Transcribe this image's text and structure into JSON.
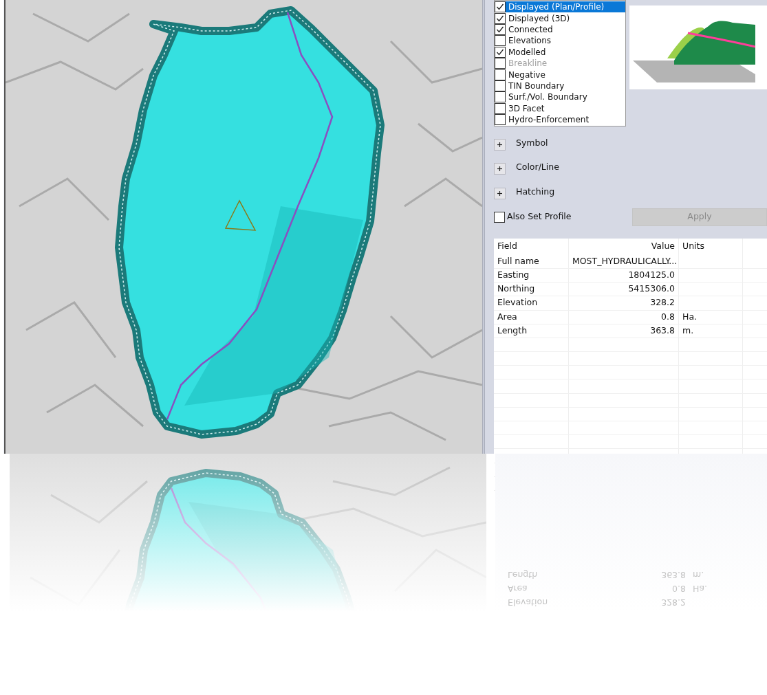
{
  "layers_list": [
    {
      "label": "Displayed (Plan/Profile)",
      "checked": true,
      "selected": true,
      "disabled": false
    },
    {
      "label": "Displayed (3D)",
      "checked": true,
      "selected": false,
      "disabled": false
    },
    {
      "label": "Connected",
      "checked": true,
      "selected": false,
      "disabled": false
    },
    {
      "label": "Elevations",
      "checked": false,
      "selected": false,
      "disabled": false
    },
    {
      "label": "Modelled",
      "checked": true,
      "selected": false,
      "disabled": false
    },
    {
      "label": "Breakline",
      "checked": false,
      "selected": false,
      "disabled": true
    },
    {
      "label": "Negative",
      "checked": false,
      "selected": false,
      "disabled": false
    },
    {
      "label": "TIN Boundary",
      "checked": false,
      "selected": false,
      "disabled": false
    },
    {
      "label": "Surf./Vol. Boundary",
      "checked": false,
      "selected": false,
      "disabled": false
    },
    {
      "label": "3D Facet",
      "checked": false,
      "selected": false,
      "disabled": false
    },
    {
      "label": "Hydro-Enforcement",
      "checked": false,
      "selected": false,
      "disabled": false
    }
  ],
  "sections": [
    {
      "label": "Symbol",
      "expanded": false
    },
    {
      "label": "Color/Line",
      "expanded": false
    },
    {
      "label": "Hatching",
      "expanded": false
    }
  ],
  "also_set_profile": {
    "label": "Also Set Profile",
    "checked": false
  },
  "apply_button": {
    "label": "Apply",
    "disabled": true
  },
  "table": {
    "columns": [
      "Field",
      "Value",
      "Units"
    ],
    "rows": [
      {
        "field": "Full name",
        "value": "MOST_HYDRAULICALLY..."
      },
      {
        "field": "Easting",
        "value": "1804125.0"
      },
      {
        "field": "Northing",
        "value": "5415306.0"
      },
      {
        "field": "Elevation",
        "value": "328.2"
      },
      {
        "field": "Area",
        "value": "0.8",
        "units": "Ha."
      },
      {
        "field": "Length",
        "value": "363.8",
        "units": "m."
      }
    ]
  },
  "reflection_rows": [
    {
      "field": "Length",
      "value": "363.8",
      "units": "m."
    },
    {
      "field": "Area",
      "value": "0.8",
      "units": "Ha."
    },
    {
      "field": "Elevation",
      "value": "328.2"
    }
  ]
}
